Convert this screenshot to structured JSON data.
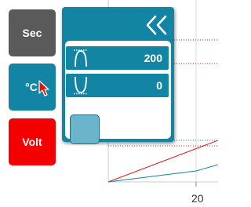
{
  "side_buttons": [
    {
      "label": "Sec",
      "color": "#5a5a5a"
    },
    {
      "label": "°C",
      "color": "#1385a4"
    },
    {
      "label": "Volt",
      "color": "#f50000"
    }
  ],
  "panel": {
    "collapse_icon": "double-chevron-left-icon",
    "rows": [
      {
        "icon": "max-peak-icon",
        "value": "200"
      },
      {
        "icon": "min-valley-icon",
        "value": "0"
      }
    ],
    "swatch_color": "#6ab4cc"
  },
  "chart": {
    "x_tick_label": "20",
    "line_colors": [
      "#e31b1b",
      "#1385a4"
    ]
  },
  "colors": {
    "accent": "#1385a4",
    "dark": "#5a5a5a",
    "alert": "#f50000"
  }
}
